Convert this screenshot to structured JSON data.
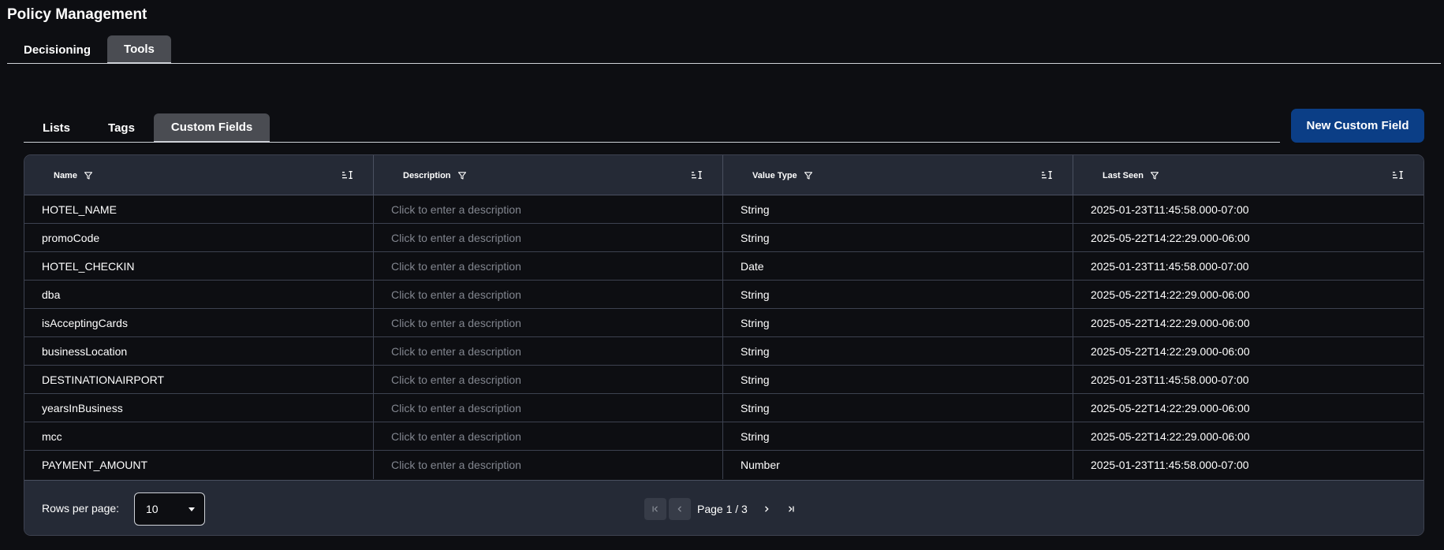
{
  "header": {
    "title": "Policy Management"
  },
  "top_tabs": [
    {
      "label": "Decisioning",
      "active": false
    },
    {
      "label": "Tools",
      "active": true
    }
  ],
  "sub_tabs": [
    {
      "label": "Lists",
      "active": false
    },
    {
      "label": "Tags",
      "active": false
    },
    {
      "label": "Custom Fields",
      "active": true
    }
  ],
  "actions": {
    "new_custom_field_label": "New Custom Field"
  },
  "table": {
    "columns": [
      {
        "label": "Name",
        "filter_icon": "filter-icon",
        "sort_icon": "sort-icon"
      },
      {
        "label": "Description",
        "filter_icon": "filter-icon",
        "sort_icon": "sort-icon"
      },
      {
        "label": "Value Type",
        "filter_icon": "filter-icon",
        "sort_icon": "sort-icon"
      },
      {
        "label": "Last Seen",
        "filter_icon": "filter-icon",
        "sort_icon": "sort-icon"
      }
    ],
    "description_placeholder": "Click to enter a description",
    "rows": [
      {
        "name": "HOTEL_NAME",
        "description": "Click to enter a description",
        "value_type": "String",
        "last_seen": "2025-01-23T11:45:58.000-07:00"
      },
      {
        "name": "promoCode",
        "description": "Click to enter a description",
        "value_type": "String",
        "last_seen": "2025-05-22T14:22:29.000-06:00"
      },
      {
        "name": "HOTEL_CHECKIN",
        "description": "Click to enter a description",
        "value_type": "Date",
        "last_seen": "2025-01-23T11:45:58.000-07:00"
      },
      {
        "name": "dba",
        "description": "Click to enter a description",
        "value_type": "String",
        "last_seen": "2025-05-22T14:22:29.000-06:00"
      },
      {
        "name": "isAcceptingCards",
        "description": "Click to enter a description",
        "value_type": "String",
        "last_seen": "2025-05-22T14:22:29.000-06:00"
      },
      {
        "name": "businessLocation",
        "description": "Click to enter a description",
        "value_type": "String",
        "last_seen": "2025-05-22T14:22:29.000-06:00"
      },
      {
        "name": "DESTINATIONAIRPORT",
        "description": "Click to enter a description",
        "value_type": "String",
        "last_seen": "2025-01-23T11:45:58.000-07:00"
      },
      {
        "name": "yearsInBusiness",
        "description": "Click to enter a description",
        "value_type": "String",
        "last_seen": "2025-05-22T14:22:29.000-06:00"
      },
      {
        "name": "mcc",
        "description": "Click to enter a description",
        "value_type": "String",
        "last_seen": "2025-05-22T14:22:29.000-06:00"
      },
      {
        "name": "PAYMENT_AMOUNT",
        "description": "Click to enter a description",
        "value_type": "Number",
        "last_seen": "2025-01-23T11:45:58.000-07:00"
      }
    ]
  },
  "pagination": {
    "rows_per_page_label": "Rows per page:",
    "rows_per_page_value": "10",
    "page_info": "Page 1 / 3",
    "icons": [
      "first-page-icon",
      "previous-page-icon",
      "next-page-icon",
      "last-page-icon"
    ]
  },
  "colors": {
    "background": "#0d0e12",
    "header_bg": "#252a36",
    "active_tab_bg": "#4a4c52",
    "primary_button": "#0b3e86",
    "placeholder_text": "#82868f"
  }
}
